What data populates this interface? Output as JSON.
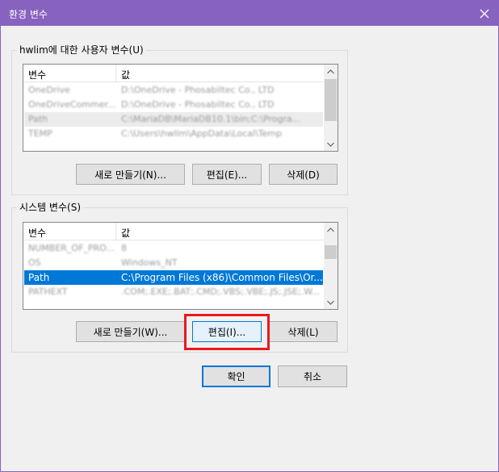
{
  "window": {
    "title": "환경 변수",
    "close_icon": "close-icon"
  },
  "user_vars": {
    "group_title": "hwlim에 대한 사용자 변수(U)",
    "columns": [
      "변수",
      "값"
    ],
    "rows": [
      {
        "name": "OneDrive",
        "value": "D:\\OneDrive - Phosabiltec Co., LTD"
      },
      {
        "name": "OneDriveCommer...",
        "value": "D:\\OneDrive - Phosabiltec Co., LTD"
      },
      {
        "name": "Path",
        "value": "C:\\MariaDB\\MariaDB10.1\\bin;C:\\Progra..."
      },
      {
        "name": "TEMP",
        "value": "C:\\Users\\hwlim\\AppData\\Local\\Temp"
      }
    ],
    "buttons": {
      "new": "새로 만들기(N)...",
      "edit": "편집(E)...",
      "delete": "삭제(D)"
    }
  },
  "system_vars": {
    "group_title": "시스템 변수(S)",
    "columns": [
      "변수",
      "값"
    ],
    "rows": [
      {
        "name": "NUMBER_OF_PRO...",
        "value": "8"
      },
      {
        "name": "OS",
        "value": "Windows_NT"
      },
      {
        "name": "Path",
        "value": "C:\\Program Files (x86)\\Common Files\\Or..."
      },
      {
        "name": "PATHEXT",
        "value": ".COM;.EXE;.BAT;.CMD;.VBS;.VBE;.JS;.JSE;.W..."
      }
    ],
    "buttons": {
      "new": "새로 만들기(W)...",
      "edit": "편집(I)...",
      "delete": "삭제(L)"
    }
  },
  "footer": {
    "ok": "확인",
    "cancel": "취소"
  },
  "colors": {
    "titlebar": "#8762be",
    "selection": "#0078d7",
    "highlight": "#e8191f"
  }
}
